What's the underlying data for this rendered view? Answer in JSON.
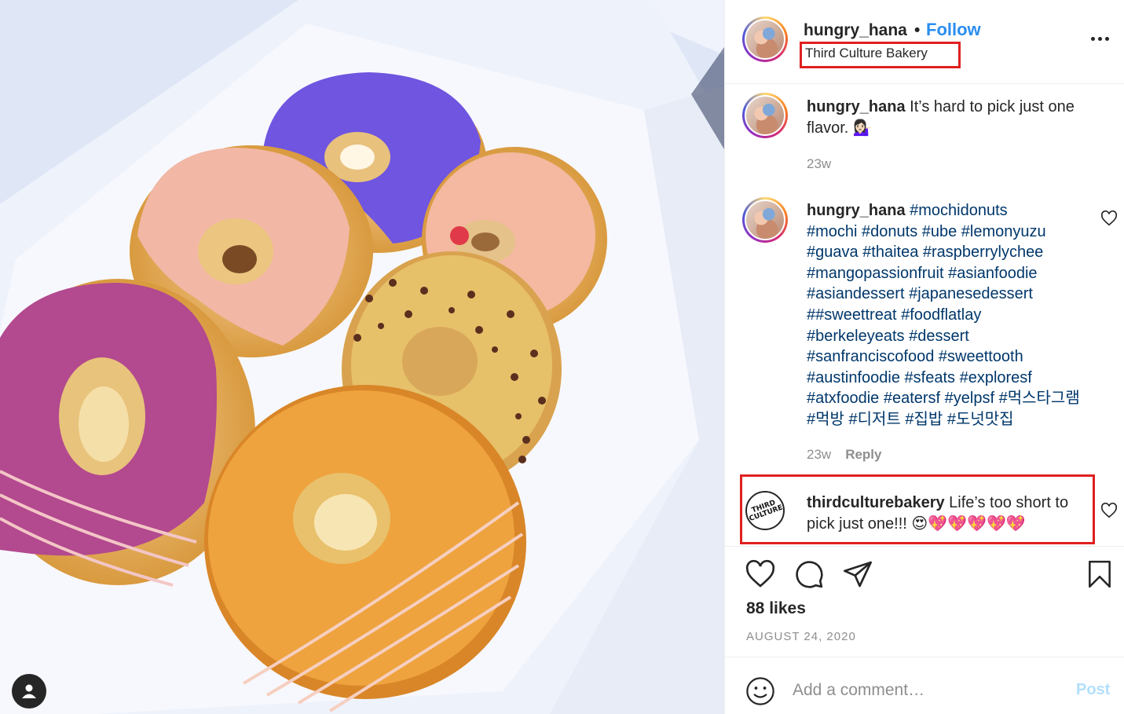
{
  "post": {
    "username": "hungry_hana",
    "separator": "•",
    "follow_label": "Follow",
    "location": "Third Culture Bakery"
  },
  "comments": [
    {
      "username": "hungry_hana",
      "text": " It’s hard to pick just one flavor. 💁🏻‍♀️",
      "age": "23w"
    },
    {
      "username": "hungry_hana",
      "hashtags_line1": "#mochidonuts",
      "hashtags_rest": "#mochi #donuts #ube #lemonyuzu #guava #thaitea #raspberrylychee #mangopassionfruit #asianfoodie #asiandessert #japanesedessert ##sweettreat #foodflatlay #berkeleyeats #dessert #sanfranciscofood #sweettooth #austinfoodie #sfeats #exploresf",
      "hashtags_last": "#atxfoodie #eatersf #yelpsf #먹스타그램 #먹방 #디저트 #집밥 #도넛맛집",
      "age": "23w",
      "reply_label": "Reply"
    },
    {
      "username": "thirdculturebakery",
      "text": " Life’s too short to pick just one!!! 😍💖💖💖💖💖",
      "avatar_text": "THIRD CULTURE"
    }
  ],
  "actions": {
    "likes": "88 likes",
    "date": "AUGUST 24, 2020"
  },
  "comment_bar": {
    "placeholder": "Add a comment…",
    "post_label": "Post"
  },
  "colors": {
    "link_blue": "#2b8ef0",
    "hashtag": "#00376b",
    "highlight_box": "#e02020",
    "muted": "#8e8e8e",
    "post_disabled": "#b2dffc"
  },
  "icons": [
    "ellipsis-icon",
    "heart-icon",
    "comment-icon",
    "share-icon",
    "bookmark-icon",
    "emoji-icon",
    "user-tag-icon"
  ]
}
